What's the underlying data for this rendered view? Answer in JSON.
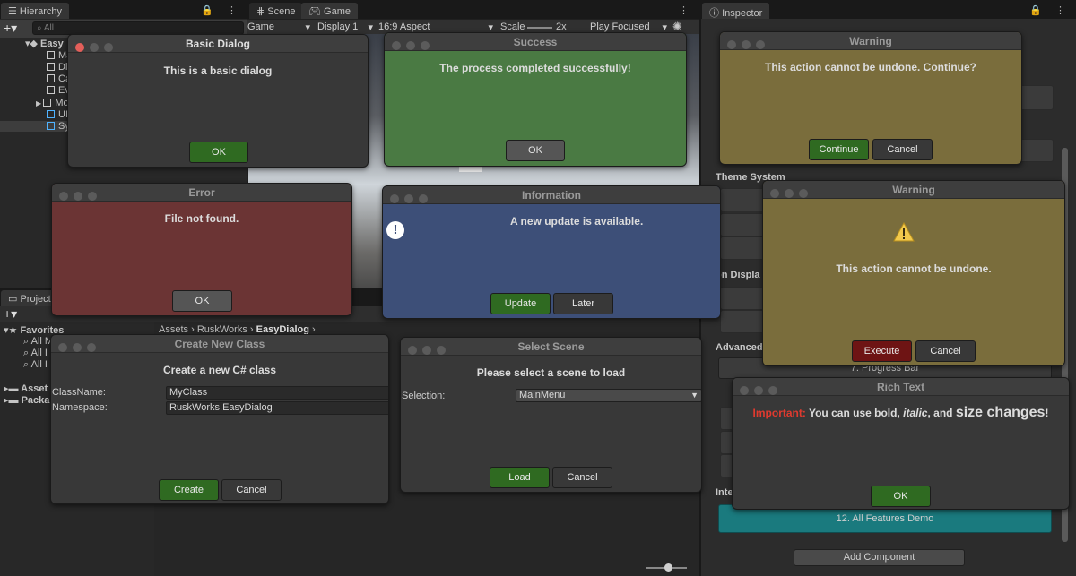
{
  "hierarchy": {
    "tab_label": "Hierarchy",
    "search_placeholder": "All",
    "items": [
      "Easy",
      "Ma",
      "Di",
      "Ca",
      "Ev",
      "Mo",
      "UI",
      "Sy"
    ]
  },
  "scene_tab": {
    "label": "Scene"
  },
  "game_tab": {
    "label": "Game",
    "toolbar": {
      "mode": "Game",
      "display": "Display 1",
      "aspect": "16:9 Aspect",
      "scale_label": "Scale",
      "scale_value": "2x",
      "play_mode": "Play Focused"
    }
  },
  "project": {
    "tab_label": "Project",
    "favorites_label": "Favorites",
    "favorites_items": [
      "All M",
      "All I",
      "All I"
    ],
    "assets_label": "Asset",
    "packages_label": "Packa",
    "breadcrumb": [
      "Assets",
      "RuskWorks",
      "EasyDialog"
    ]
  },
  "inspector": {
    "tab_label": "Inspector",
    "section_theme": "Theme System",
    "section_icon": "on Displa",
    "section_advanced": "Advanced I",
    "section_inte": "Inte",
    "progress_bar_label": "7. Progress Bar",
    "all_features_label": "12. All Features Demo",
    "add_component": "Add Component",
    "accent_color": "#1a7a7e"
  },
  "dialogs": {
    "basic": {
      "title": "Basic Dialog",
      "message": "This is a basic dialog",
      "ok": "OK"
    },
    "success": {
      "title": "Success",
      "message": "The process completed successfully!",
      "ok": "OK",
      "color": "#4a7a43"
    },
    "warning_confirm": {
      "title": "Warning",
      "message": "This action cannot be undone. Continue?",
      "continue": "Continue",
      "cancel": "Cancel",
      "color": "#7a6d3c"
    },
    "error": {
      "title": "Error",
      "message": "File not found.",
      "ok": "OK",
      "color": "#6b3434"
    },
    "information": {
      "title": "Information",
      "message": "A new update is available.",
      "update": "Update",
      "later": "Later",
      "color": "#3d4f78"
    },
    "warning_icon": {
      "title": "Warning",
      "message": "This action cannot be undone.",
      "execute": "Execute",
      "cancel": "Cancel",
      "color": "#7a6d3c"
    },
    "create_class": {
      "title": "Create New Class",
      "message": "Create a new C# class",
      "classname_label": "ClassName:",
      "classname_value": "MyClass",
      "namespace_label": "Namespace:",
      "namespace_value": "RuskWorks.EasyDialog",
      "create": "Create",
      "cancel": "Cancel"
    },
    "select_scene": {
      "title": "Select Scene",
      "message": "Please select a scene to load",
      "selection_label": "Selection:",
      "selection_value": "MainMenu",
      "load": "Load",
      "cancel": "Cancel"
    },
    "rich_text": {
      "title": "Rich Text",
      "important": "Important:",
      "part1": " You can use bold, ",
      "italic": "italic",
      "part2": ", and ",
      "size": "size changes",
      "part3": "!",
      "ok": "OK"
    }
  }
}
